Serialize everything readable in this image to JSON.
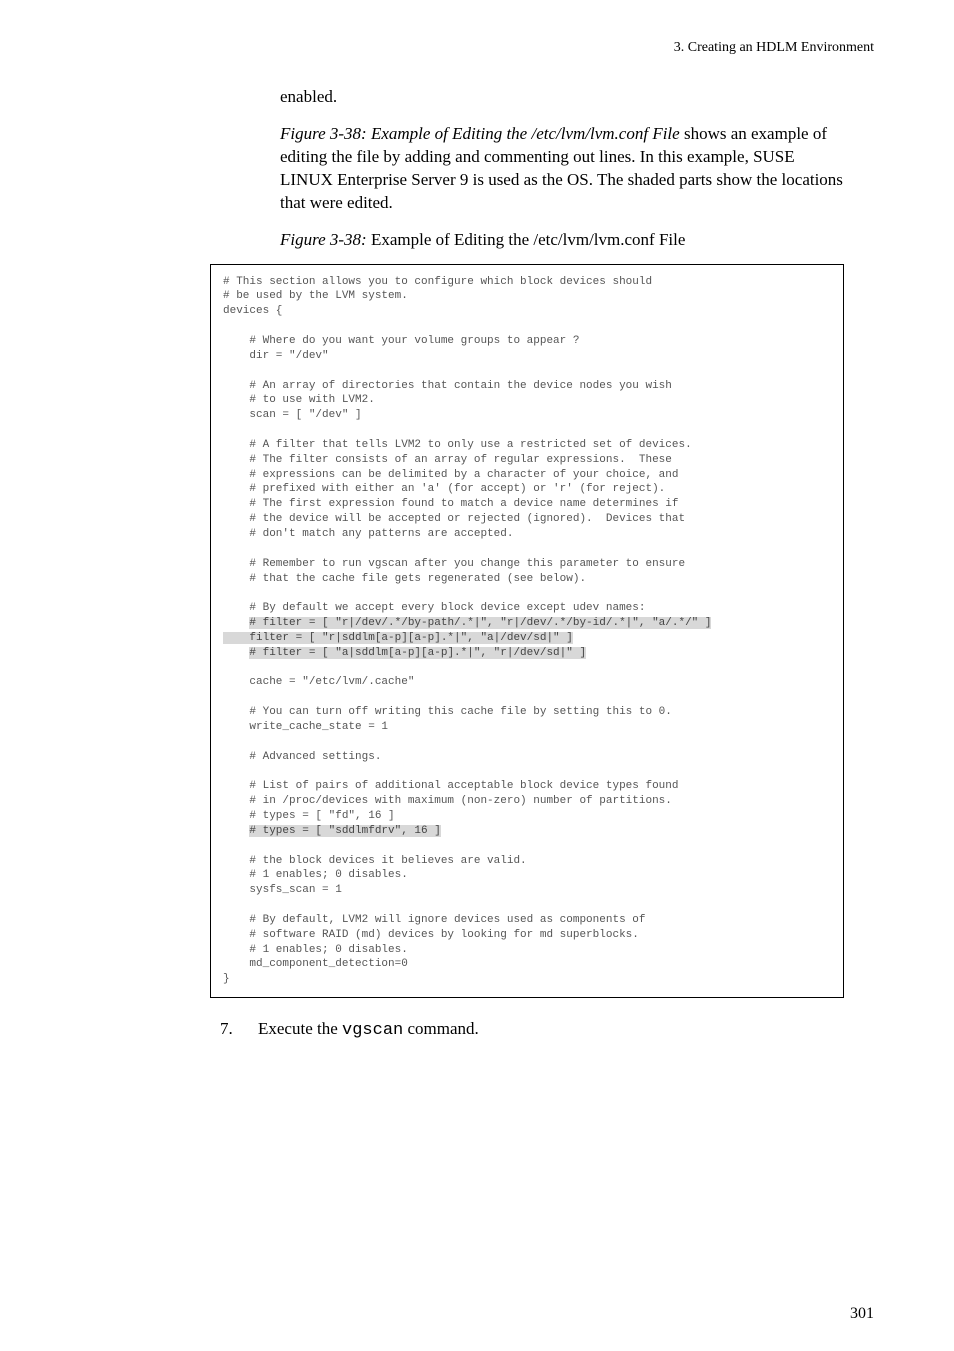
{
  "running_head": "3. Creating an HDLM Environment",
  "para_enabled": "enabled.",
  "para_intro_prefix_italic": "Figure  3-38:  Example of Editing the /etc/lvm/lvm.conf File",
  "para_intro_rest": " shows an example of editing the file by adding and commenting out lines. In this example, SUSE LINUX Enterprise Server 9 is used as the OS. The shaded parts show the locations that were edited.",
  "figcaption_label": "Figure  3-38:",
  "figcaption_text": "  Example of Editing the /etc/lvm/lvm.conf File",
  "code": {
    "l01": "# This section allows you to configure which block devices should",
    "l02": "# be used by the LVM system.",
    "l03": "devices {",
    "l04": "",
    "l05": "    # Where do you want your volume groups to appear ?",
    "l06": "    dir = \"/dev\"",
    "l07": "",
    "l08": "    # An array of directories that contain the device nodes you wish",
    "l09": "    # to use with LVM2.",
    "l10": "    scan = [ \"/dev\" ]",
    "l11": "",
    "l12": "    # A filter that tells LVM2 to only use a restricted set of devices.",
    "l13": "    # The filter consists of an array of regular expressions.  These",
    "l14": "    # expressions can be delimited by a character of your choice, and",
    "l15": "    # prefixed with either an 'a' (for accept) or 'r' (for reject).",
    "l16": "    # The first expression found to match a device name determines if",
    "l17": "    # the device will be accepted or rejected (ignored).  Devices that",
    "l18": "    # don't match any patterns are accepted.",
    "l19": "",
    "l20": "    # Remember to run vgscan after you change this parameter to ensure",
    "l21": "    # that the cache file gets regenerated (see below).",
    "l22": "",
    "l23": "    # By default we accept every block device except udev names:",
    "l24a": "    ",
    "l24b": "# filter = [ \"r|/dev/.*/by-path/.*|\", \"r|/dev/.*/by-id/.*|\", \"a/.*/\" ]",
    "l25": "    filter = [ \"r|sddlm[a-p][a-p].*|\", \"a|/dev/sd|\" ]",
    "l26a": "    ",
    "l26b": "# filter = [ \"a|sddlm[a-p][a-p].*|\", \"r|/dev/sd|\" ]",
    "l27": "",
    "l28": "    cache = \"/etc/lvm/.cache\"",
    "l29": "",
    "l30": "    # You can turn off writing this cache file by setting this to 0.",
    "l31": "    write_cache_state = 1",
    "l32": "",
    "l33": "    # Advanced settings.",
    "l34": "",
    "l35": "    # List of pairs of additional acceptable block device types found",
    "l36": "    # in /proc/devices with maximum (non-zero) number of partitions.",
    "l37": "    # types = [ \"fd\", 16 ]",
    "l38a": "    ",
    "l38b": "# types = [ \"sddlmfdrv\", 16 ]",
    "l39": "",
    "l40": "    # the block devices it believes are valid.",
    "l41": "    # 1 enables; 0 disables.",
    "l42": "    sysfs_scan = 1",
    "l43": "",
    "l44": "    # By default, LVM2 will ignore devices used as components of",
    "l45": "    # software RAID (md) devices by looking for md superblocks.",
    "l46": "    # 1 enables; 0 disables.",
    "l47": "    md_component_detection=0",
    "l48": "}"
  },
  "step7_num": "7.",
  "step7_text_a": "Execute the ",
  "step7_cmd": "vgscan",
  "step7_text_b": " command.",
  "page_number": "301"
}
